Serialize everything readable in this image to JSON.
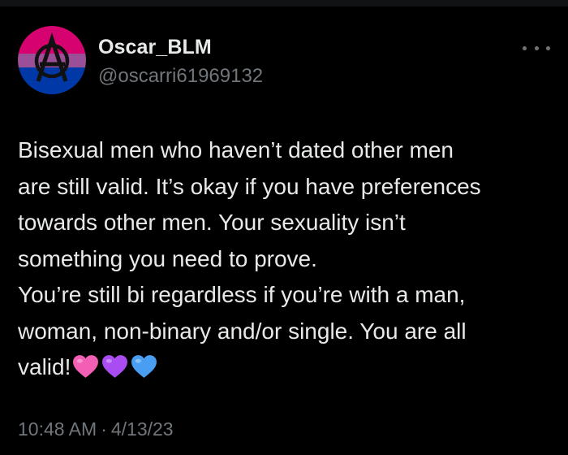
{
  "author": {
    "display_name": "Oscar_BLM",
    "handle": "@oscarri61969132",
    "avatar_icon": "bisexual-flag-anarchy-avatar"
  },
  "tweet": {
    "lines": [
      "Bisexual men who haven’t dated other men",
      "are still valid. It’s okay if you have preferences",
      "towards other men. Your sexuality isn’t",
      "something you need to prove.",
      "You’re still bi regardless if you’re with a man,",
      "woman, non-binary and/or single. You are all",
      "valid!"
    ],
    "emoji": [
      "pink-heart-icon",
      "purple-heart-icon",
      "blue-heart-icon"
    ]
  },
  "meta": {
    "time": "10:48 AM",
    "separator": "·",
    "date": "4/13/23"
  },
  "colors": {
    "background": "#000000",
    "text_primary": "#e7e9ea",
    "text_secondary": "#71767b",
    "flag_pink": "#d60270",
    "flag_purple": "#9b4f96",
    "flag_blue": "#0038a8",
    "heart_pink": "#f35fb4",
    "heart_purple": "#a94df2",
    "heart_blue": "#4a9ef2"
  }
}
